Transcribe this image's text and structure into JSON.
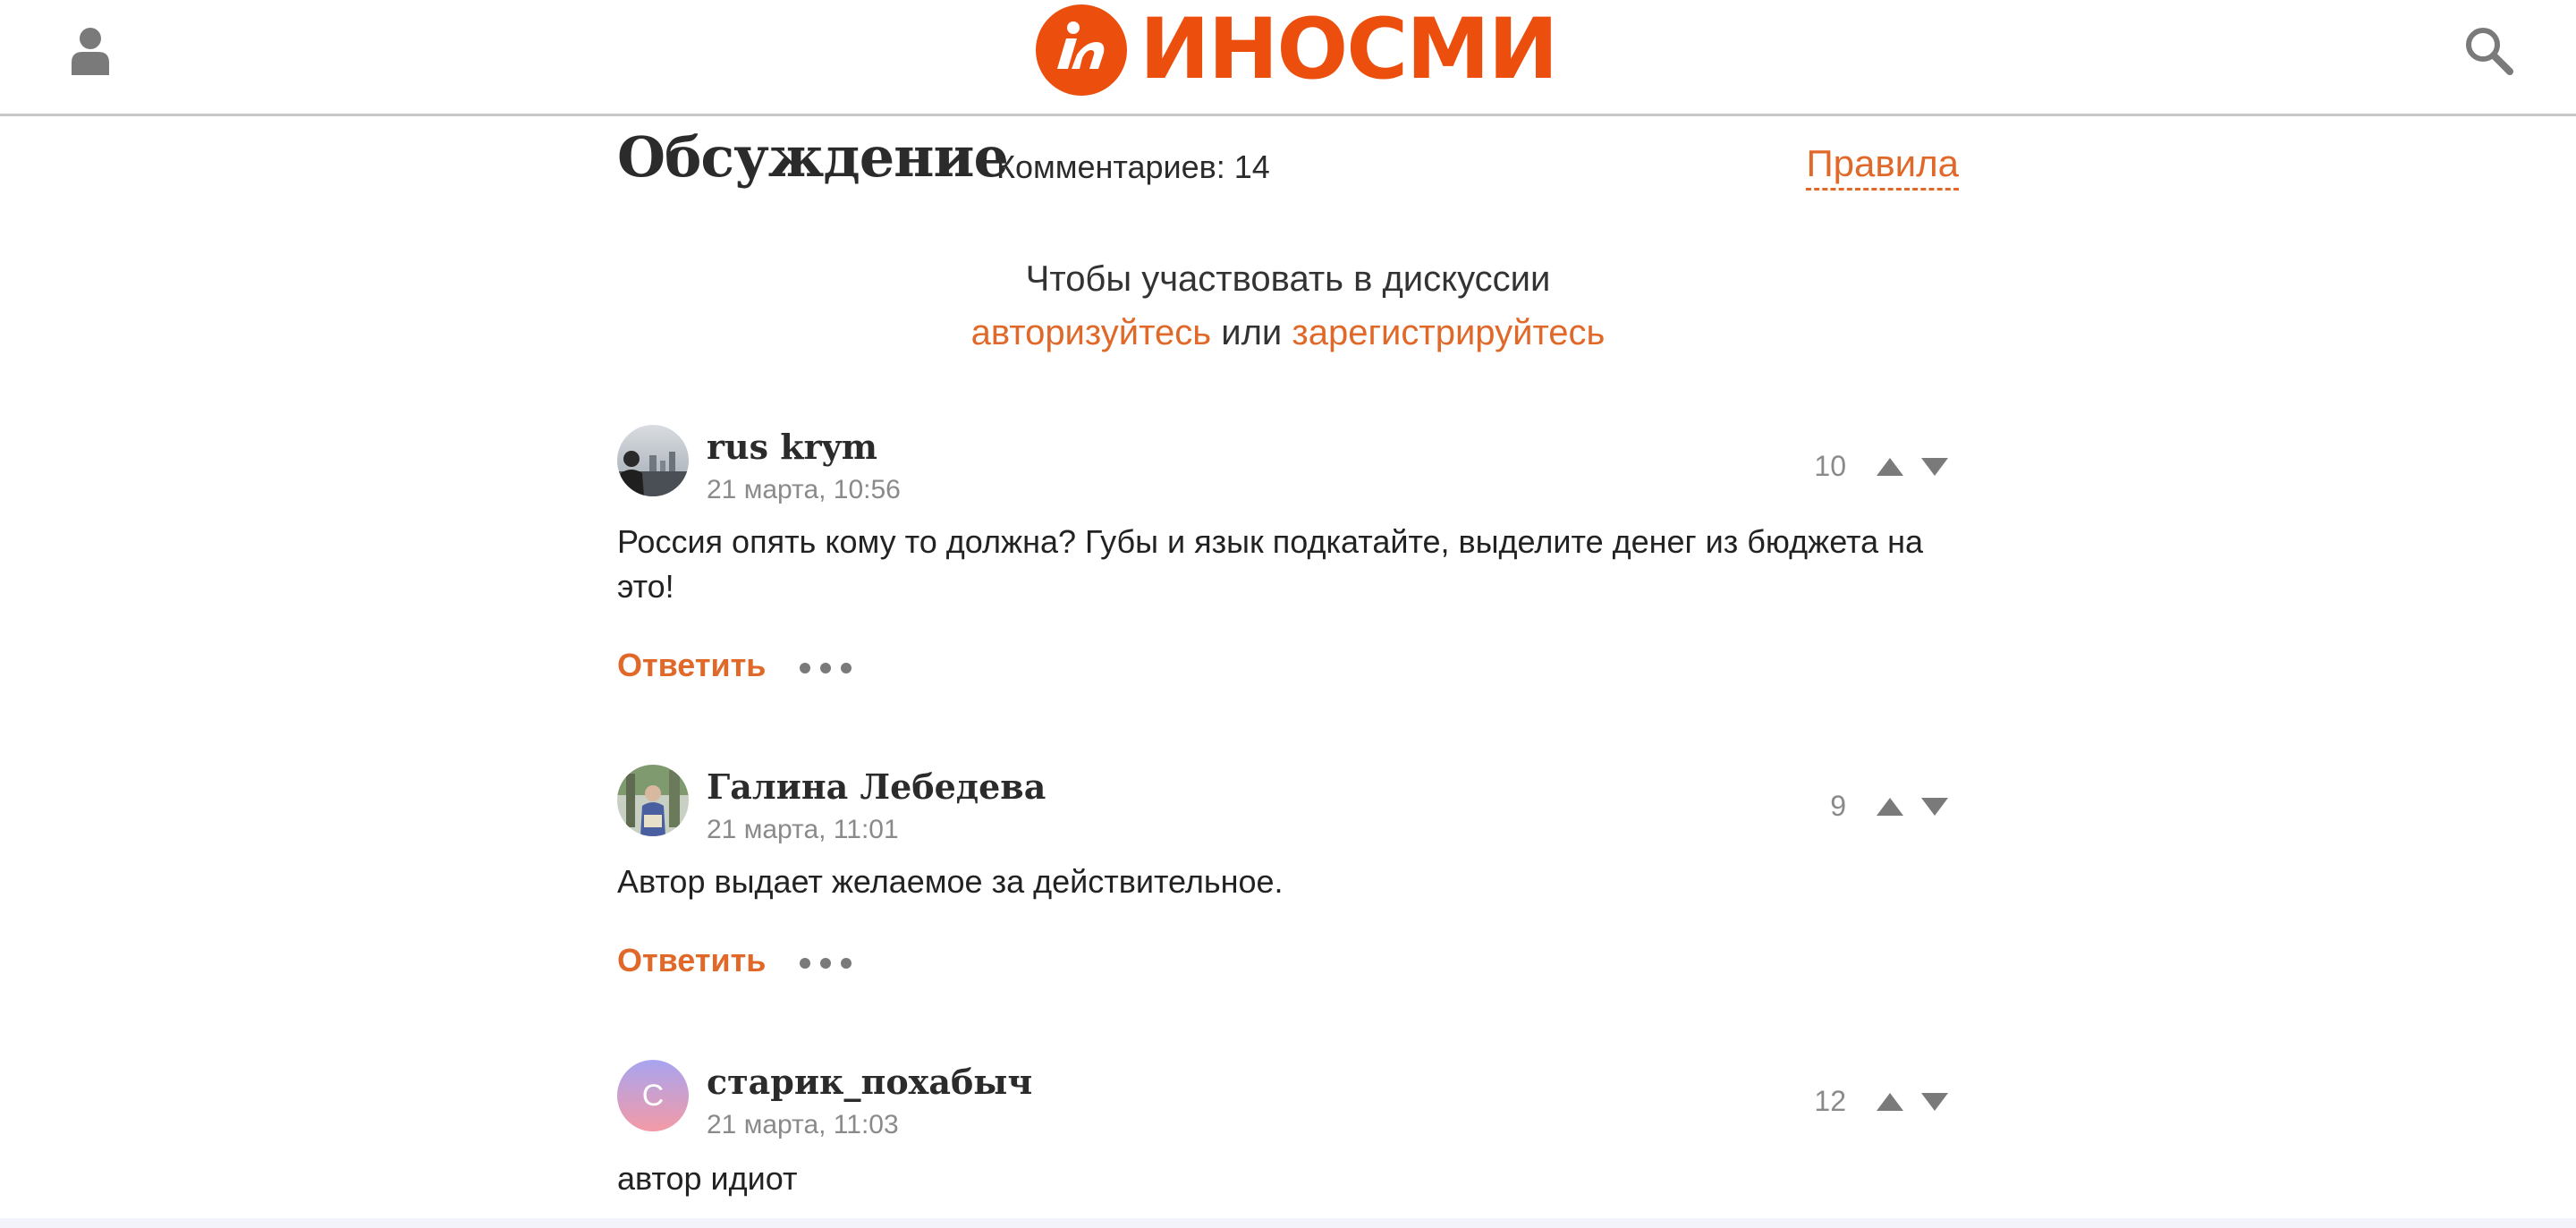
{
  "header": {
    "logo_text": "ИНОСМИ",
    "brand_color": "#ec4e0e",
    "user_icon": "user-icon",
    "search_icon": "search-icon"
  },
  "discussion": {
    "title": "Обсуждение",
    "count_label": "Комментариев: 14",
    "rules_label": "Правила"
  },
  "auth": {
    "prompt": "Чтобы участвовать в дискуссии",
    "login_link": "авторизуйтесь",
    "or": "или",
    "register_link": "зарегистрируйтесь"
  },
  "comments": [
    {
      "author": "rus krym",
      "date": "21 марта, 10:56",
      "votes": "10",
      "text": "Россия опять кому то должна? Губы и язык подкатайте, выделите денег из бюджета на это!",
      "reply_label": "Ответить"
    },
    {
      "author": "Галина Лебедева",
      "date": "21 марта, 11:01",
      "votes": "9",
      "text": "Автор выдает желаемое за действительное.",
      "reply_label": "Ответить"
    },
    {
      "author": "старик_похабыч",
      "date": "21 марта, 11:03",
      "votes": "12",
      "text": "автор идиот",
      "avatar_letter": "С"
    }
  ],
  "colors": {
    "accent": "#e0692a",
    "muted": "#8a8a8a",
    "icon_gray": "#7a7a7a"
  }
}
